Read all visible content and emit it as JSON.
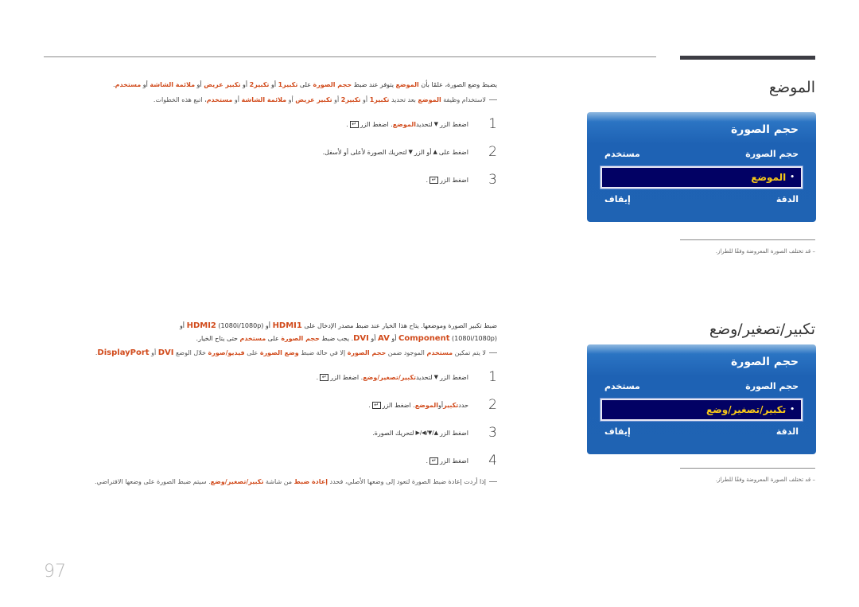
{
  "page_number": "97",
  "colors": {
    "accent": "#d14b1c",
    "osd_blue": "#1f63b3",
    "osd_selected_bg": "#020164",
    "osd_selected_text": "#f7c818"
  },
  "section1": {
    "title": "الموضع",
    "intro": {
      "t1": "يضبط وضع الصورة، علمًا بأن ",
      "h1": "الموضع",
      "t2": " يتوفر عند ضبط ",
      "h2": "حجم الصورة",
      "t3": " على ",
      "h3": "تكبير1",
      "t4": " أو ",
      "h4": "تكبير2",
      "t5": " أو ",
      "h5": "تكبير عريض",
      "t6": " أو ",
      "h6": "ملائمة الشاشة",
      "t7": " أو ",
      "h7": "مستخدم",
      "t8": "."
    },
    "note": {
      "t1": "لاستخدام وظيفة ",
      "h1": "الموضع",
      "t2": " بعد تحديد ",
      "h2": "تكبير1",
      "t3": " أو ",
      "h3": "تكبير2",
      "t4": " أو ",
      "h4": "تكبير عريض",
      "t5": " أو ",
      "h5": "ملائمة الشاشة",
      "t6": " أو ",
      "h6": "مستخدم",
      "t7": "، اتبع هذه الخطوات."
    },
    "steps": [
      {
        "num": "1",
        "t1": "اضغط الزر ",
        "icon": "▼",
        "t2": " لتحديد ",
        "h1": "الموضع",
        "t3": ". اضغط الزر ",
        "key": "↵",
        "t4": "."
      },
      {
        "num": "2",
        "t1": "اضغط على ",
        "icon": "▲",
        "t2": " أو الزر ",
        "icon2": "▼",
        "t3": " لتحريك الصورة لأعلى أو لأسفل."
      },
      {
        "num": "3",
        "t1": "اضغط الزر ",
        "key": "↵",
        "t2": "."
      }
    ],
    "osd": {
      "title": "حجم الصورة",
      "rows": [
        {
          "label": "حجم الصورة",
          "value": "مستخدم"
        },
        {
          "label": "الموضع",
          "selected": true
        },
        {
          "label": "الدقة",
          "value": "إيقاف"
        }
      ]
    },
    "side_note": "– قد تختلف الصورة المعروضة وفقًا للطراز."
  },
  "section2": {
    "title": "تكبير/تصغير/وضع",
    "intro": {
      "t1": "ضبط تكبير الصورة وموضعها. يتاح هذا الخيار عند ضبط مصدر الإدخال على ",
      "h1": "HDMI1",
      "t2": " أو ",
      "h2": "HDMI2",
      "t3": " (1080i/1080p) أو",
      "h3": "Component",
      "t4": " (1080i/1080p) أو ",
      "h4": "AV",
      "t5": " أو ",
      "h5": "DVI",
      "t6": ". يجب ضبط ",
      "h6": "حجم الصورة",
      "t7": " على ",
      "h7": "مستخدم",
      "t8": " حتى يتاح الخيار."
    },
    "note": {
      "t1": "لا يتم تمكين ",
      "h1": "مستخدم",
      "t2": " الموجود ضمن ",
      "h2": "حجم الصورة",
      "t3": " إلا في حالة ضبط ",
      "h3": "وضع الصورة",
      "t4": " على ",
      "h4": "فيديو/صورة",
      "t5": " خلال الوضع ",
      "h5": "DVI",
      "t6": " أو ",
      "h6": "DisplayPort",
      "t7": "."
    },
    "steps": [
      {
        "num": "1",
        "t1": "اضغط الزر ",
        "icon": "▼",
        "t2": " لتحديد ",
        "h1": "تكبير/تصغير/وضع",
        "t3": ". اضغط الزر ",
        "key": "↵",
        "t4": "."
      },
      {
        "num": "2",
        "t1": "حدد ",
        "h1": "تكبير",
        "t2": " أو ",
        "h2": "الموضع",
        "t3": ". اضغط الزر ",
        "key": "↵",
        "t4": "."
      },
      {
        "num": "3",
        "t1": "اضغط الزر ",
        "icon": "▲/▼/◀/▶",
        "t2": " لتحريك الصورة."
      },
      {
        "num": "4",
        "t1": "اضغط الزر ",
        "key": "↵",
        "t2": "."
      }
    ],
    "note2": {
      "t1": "إذا أردت إعادة ضبط الصورة لتعود إلى وضعها الأصلي، فحدد ",
      "h1": "إعادة ضبط",
      "t2": " من شاشة ",
      "h2": "تكبير/تصغير/وضع",
      "t3": ". سيتم ضبط الصورة على وضعها الافتراضي."
    },
    "osd": {
      "title": "حجم الصورة",
      "rows": [
        {
          "label": "حجم الصورة",
          "value": "مستخدم"
        },
        {
          "label": "تكبير/تصغير/وضع",
          "selected": true
        },
        {
          "label": "الدقة",
          "value": "إيقاف"
        }
      ]
    },
    "side_note": "– قد تختلف الصورة المعروضة وفقًا للطراز."
  }
}
